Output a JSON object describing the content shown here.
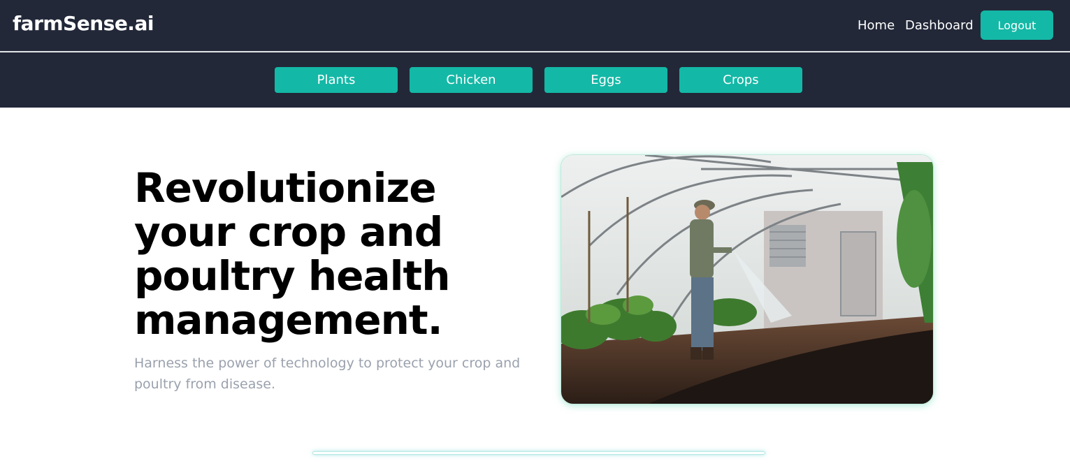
{
  "header": {
    "brand": "farmSense.ai",
    "nav": {
      "home": "Home",
      "dashboard": "Dashboard"
    },
    "logout_label": "Logout"
  },
  "categories": [
    "Plants",
    "Chicken",
    "Eggs",
    "Crops"
  ],
  "hero": {
    "title": "Revolutionize your crop and poultry health management.",
    "subtitle": "Harness the power of technology to protect your crop and poultry from disease."
  },
  "colors": {
    "navbar": "#222838",
    "accent": "#14b8a6",
    "subtitle": "#9aa1ad"
  }
}
